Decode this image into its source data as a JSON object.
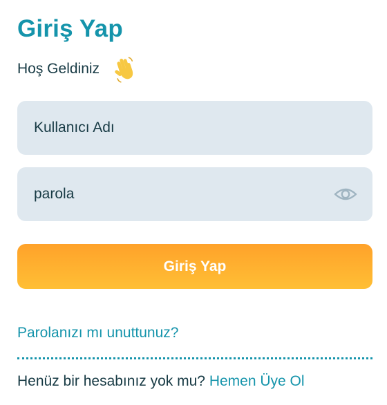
{
  "header": {
    "title": "Giriş Yap",
    "welcome": "Hoş Geldiniz",
    "wave_icon": "waving-hand-icon"
  },
  "form": {
    "username_placeholder": "Kullanıcı Adı",
    "password_placeholder": "parola",
    "password_toggle_icon": "eye-icon",
    "submit_label": "Giriş Yap"
  },
  "links": {
    "forgot_password": "Parolanızı mı unuttunuz?",
    "signup_prompt": "Henüz bir hesabınız yok mu?",
    "signup_link": "Hemen Üye Ol"
  },
  "colors": {
    "accent": "#1594ab",
    "text": "#173a44",
    "field_bg": "#dfe8ef",
    "button_gradient_top": "#ffa22a",
    "button_gradient_bottom": "#ffbf35"
  }
}
